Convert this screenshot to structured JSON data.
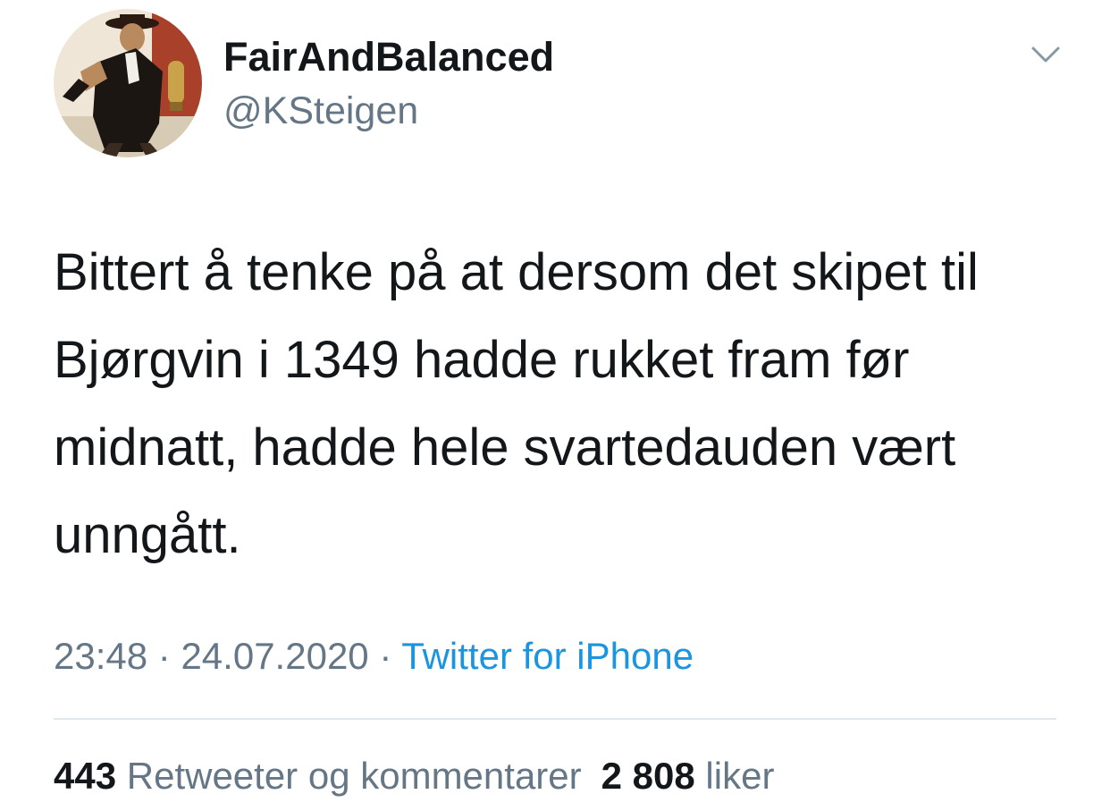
{
  "author": {
    "display_name": "FairAndBalanced",
    "handle": "@KSteigen",
    "avatar_icon": "avatar-portrait-icon"
  },
  "tweet": {
    "text": "Bittert å tenke på at dersom det skipet til Bjørgvin i 1349 hadde rukket fram før midnatt, hadde hele svartedauden vært unngått.",
    "time": "23:48",
    "separator": "·",
    "date": "24.07.2020",
    "source": "Twitter for iPhone"
  },
  "stats": {
    "retweets_count": "443",
    "retweets_label": "Retweeter og kommentarer",
    "likes_count": "2 808",
    "likes_label": "liker"
  },
  "icons": {
    "menu": "chevron-down-icon"
  },
  "colors": {
    "text": "#14171a",
    "secondary": "#657786",
    "link": "#1b95e0",
    "divider": "#e1e8ed"
  }
}
